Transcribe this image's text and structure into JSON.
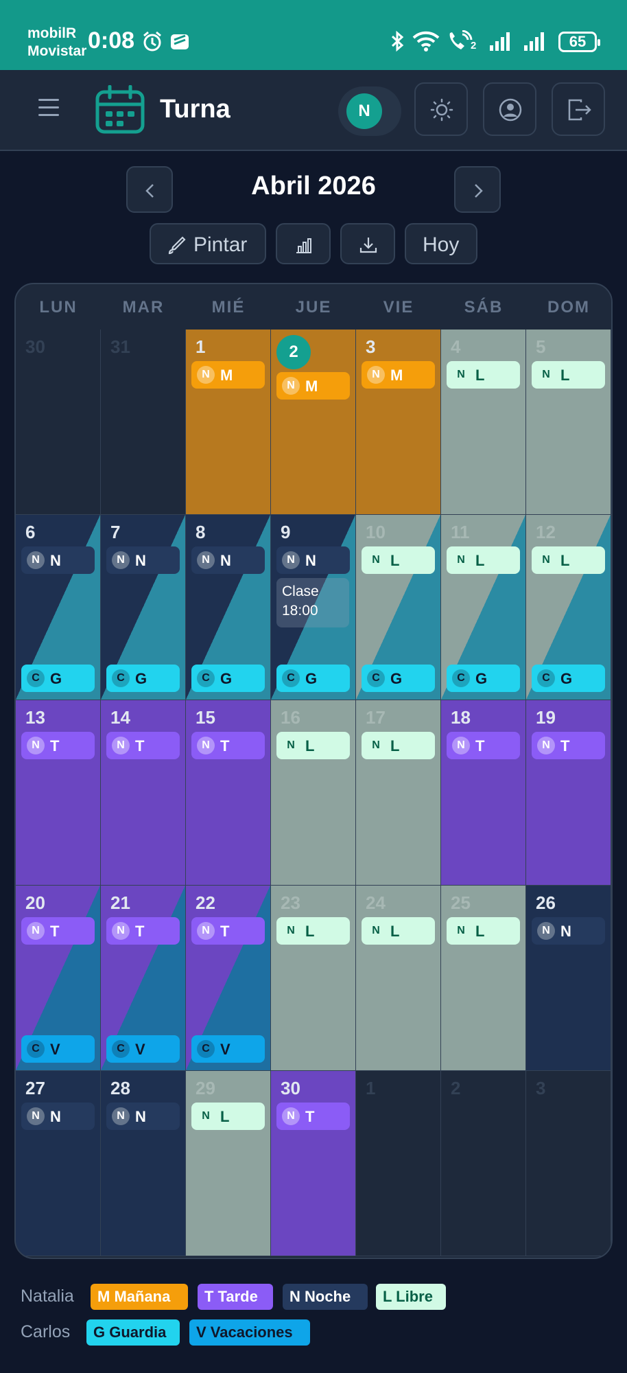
{
  "status_bar": {
    "carrier_line1": "mobilR",
    "carrier_line2": "Movistar",
    "time": "0:08",
    "battery": "65",
    "signal_sub": "2",
    "icons": [
      "alarm-icon",
      "app-notification-icon",
      "bluetooth-icon",
      "wifi-icon",
      "volte-call-icon",
      "signal-icon",
      "signal-icon"
    ]
  },
  "header": {
    "app_name": "Turna",
    "user_initial": "N",
    "icons": [
      "menu-icon",
      "calendar-logo-icon",
      "theme-sun-icon",
      "profile-icon",
      "logout-icon"
    ]
  },
  "calendar": {
    "month_title": "Abril 2026",
    "toolbar": {
      "paint_label": "Pintar",
      "today_label": "Hoy"
    },
    "weekdays": [
      "LUN",
      "MAR",
      "MIÉ",
      "JUE",
      "VIE",
      "SÁB",
      "DOM"
    ],
    "weeks": [
      [
        {
          "day": "30",
          "other": true
        },
        {
          "day": "31",
          "other": true
        },
        {
          "day": "1",
          "bg": "M",
          "chips": [
            {
              "p": "N",
              "s": "M"
            }
          ]
        },
        {
          "day": "2",
          "today": true,
          "bg": "M",
          "chips": [
            {
              "p": "N",
              "s": "M"
            }
          ]
        },
        {
          "day": "3",
          "bg": "M",
          "chips": [
            {
              "p": "N",
              "s": "M"
            }
          ]
        },
        {
          "day": "4",
          "bg": "L",
          "chips": [
            {
              "p": "N",
              "s": "L"
            }
          ]
        },
        {
          "day": "5",
          "bg": "L",
          "chips": [
            {
              "p": "N",
              "s": "L"
            }
          ]
        }
      ],
      [
        {
          "day": "6",
          "bg": "N",
          "bg2": "G",
          "chips": [
            {
              "p": "N",
              "s": "N"
            }
          ],
          "bottom": {
            "p": "C",
            "s": "G"
          }
        },
        {
          "day": "7",
          "bg": "N",
          "bg2": "G",
          "chips": [
            {
              "p": "N",
              "s": "N"
            }
          ],
          "bottom": {
            "p": "C",
            "s": "G"
          }
        },
        {
          "day": "8",
          "bg": "N",
          "bg2": "G",
          "chips": [
            {
              "p": "N",
              "s": "N"
            }
          ],
          "bottom": {
            "p": "C",
            "s": "G"
          }
        },
        {
          "day": "9",
          "bg": "N",
          "bg2": "G",
          "chips": [
            {
              "p": "N",
              "s": "N"
            }
          ],
          "bottom": {
            "p": "C",
            "s": "G"
          },
          "note": [
            "Clase",
            "18:00"
          ]
        },
        {
          "day": "10",
          "bg": "L",
          "bg2": "G",
          "chips": [
            {
              "p": "N",
              "s": "L"
            }
          ],
          "bottom": {
            "p": "C",
            "s": "G"
          }
        },
        {
          "day": "11",
          "bg": "L",
          "bg2": "G",
          "chips": [
            {
              "p": "N",
              "s": "L"
            }
          ],
          "bottom": {
            "p": "C",
            "s": "G"
          }
        },
        {
          "day": "12",
          "bg": "L",
          "bg2": "G",
          "chips": [
            {
              "p": "N",
              "s": "L"
            }
          ],
          "bottom": {
            "p": "C",
            "s": "G"
          }
        }
      ],
      [
        {
          "day": "13",
          "bg": "T",
          "chips": [
            {
              "p": "N",
              "s": "T"
            }
          ]
        },
        {
          "day": "14",
          "bg": "T",
          "chips": [
            {
              "p": "N",
              "s": "T"
            }
          ]
        },
        {
          "day": "15",
          "bg": "T",
          "chips": [
            {
              "p": "N",
              "s": "T"
            }
          ]
        },
        {
          "day": "16",
          "bg": "L",
          "chips": [
            {
              "p": "N",
              "s": "L"
            }
          ]
        },
        {
          "day": "17",
          "bg": "L",
          "chips": [
            {
              "p": "N",
              "s": "L"
            }
          ]
        },
        {
          "day": "18",
          "bg": "T",
          "chips": [
            {
              "p": "N",
              "s": "T"
            }
          ]
        },
        {
          "day": "19",
          "bg": "T",
          "chips": [
            {
              "p": "N",
              "s": "T"
            }
          ]
        }
      ],
      [
        {
          "day": "20",
          "bg": "T",
          "bg2": "V",
          "chips": [
            {
              "p": "N",
              "s": "T"
            }
          ],
          "bottom": {
            "p": "C",
            "s": "V"
          }
        },
        {
          "day": "21",
          "bg": "T",
          "bg2": "V",
          "chips": [
            {
              "p": "N",
              "s": "T"
            }
          ],
          "bottom": {
            "p": "C",
            "s": "V"
          }
        },
        {
          "day": "22",
          "bg": "T",
          "bg2": "V",
          "chips": [
            {
              "p": "N",
              "s": "T"
            }
          ],
          "bottom": {
            "p": "C",
            "s": "V"
          }
        },
        {
          "day": "23",
          "bg": "L",
          "chips": [
            {
              "p": "N",
              "s": "L"
            }
          ]
        },
        {
          "day": "24",
          "bg": "L",
          "chips": [
            {
              "p": "N",
              "s": "L"
            }
          ]
        },
        {
          "day": "25",
          "bg": "L",
          "chips": [
            {
              "p": "N",
              "s": "L"
            }
          ]
        },
        {
          "day": "26",
          "bg": "N",
          "chips": [
            {
              "p": "N",
              "s": "N"
            }
          ]
        }
      ],
      [
        {
          "day": "27",
          "bg": "N",
          "chips": [
            {
              "p": "N",
              "s": "N"
            }
          ]
        },
        {
          "day": "28",
          "bg": "N",
          "chips": [
            {
              "p": "N",
              "s": "N"
            }
          ]
        },
        {
          "day": "29",
          "bg": "L",
          "chips": [
            {
              "p": "N",
              "s": "L"
            }
          ]
        },
        {
          "day": "30",
          "bg": "T",
          "chips": [
            {
              "p": "N",
              "s": "T"
            }
          ]
        },
        {
          "day": "1",
          "other": true
        },
        {
          "day": "2",
          "other": true
        },
        {
          "day": "3",
          "other": true
        }
      ]
    ]
  },
  "shift_colors": {
    "M": {
      "bg": "#b7791f",
      "chip": "#f59e0b",
      "text": "#ffffff",
      "dot": "#fbbf6a"
    },
    "T": {
      "bg": "#6b46c1",
      "chip": "#8b5cf6",
      "text": "#ffffff",
      "dot": "#a78bfa"
    },
    "N": {
      "bg": "#1e3050",
      "chip": "#253a5e",
      "text": "#ffffff",
      "dot": "#475569"
    },
    "L": {
      "bg": "#8ea39e",
      "chip": "#d1fae5",
      "text": "#065f46",
      "dot": "#d1fae5"
    },
    "G": {
      "bg": "#2b8ba3",
      "chip": "#22d3ee",
      "text": "#0f172a",
      "dot": "#0e7490"
    },
    "V": {
      "bg": "#1e6fa1",
      "chip": "#0ea5e9",
      "text": "#0f172a",
      "dot": "#0369a1"
    }
  },
  "legend": {
    "rows": [
      {
        "name": "Natalia",
        "items": [
          {
            "code": "M",
            "label": "M Mañana"
          },
          {
            "code": "T",
            "label": "T Tarde"
          },
          {
            "code": "N",
            "label": "N Noche"
          },
          {
            "code": "L",
            "label": "L Libre"
          }
        ]
      },
      {
        "name": "Carlos",
        "items": [
          {
            "code": "G",
            "label": "G Guardia"
          },
          {
            "code": "V",
            "label": "V Vacaciones"
          }
        ]
      }
    ]
  }
}
